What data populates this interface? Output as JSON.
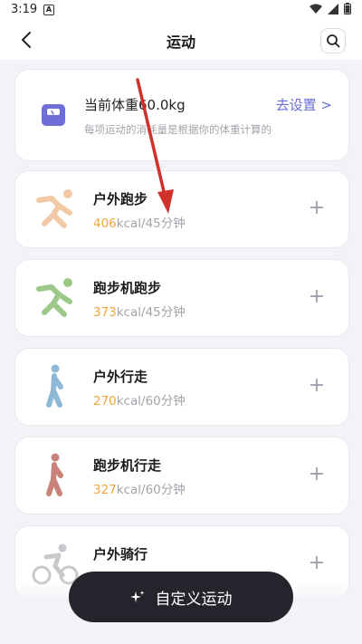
{
  "status_bar": {
    "time": "3:19",
    "notif_letter": "A"
  },
  "app_bar": {
    "title": "运动"
  },
  "weight_card": {
    "label": "当前体重60.0kg",
    "subtitle": "每项运动的消耗量是根据你的体重计算的",
    "set_link": "去设置 >"
  },
  "sports": [
    {
      "name": "户外跑步",
      "kcal": "406",
      "rest": "kcal/45分钟",
      "icon": "running-icon",
      "color": "#f1c9a4"
    },
    {
      "name": "跑步机跑步",
      "kcal": "373",
      "rest": "kcal/45分钟",
      "icon": "running-icon",
      "color": "#9cc98a"
    },
    {
      "name": "户外行走",
      "kcal": "270",
      "rest": "kcal/60分钟",
      "icon": "walking-icon",
      "color": "#8fb9d6"
    },
    {
      "name": "跑步机行走",
      "kcal": "327",
      "rest": "kcal/60分钟",
      "icon": "walking-icon",
      "color": "#c9827a"
    },
    {
      "name": "户外骑行",
      "kcal": "",
      "rest": "",
      "icon": "cycling-icon",
      "color": "#c8c8cc"
    }
  ],
  "custom_button": {
    "label": "自定义运动",
    "icon": "sparkle-icon"
  },
  "colors": {
    "accent": "#6a6fd6",
    "kcal": "#f1a53a",
    "button_bg": "#26232d"
  }
}
